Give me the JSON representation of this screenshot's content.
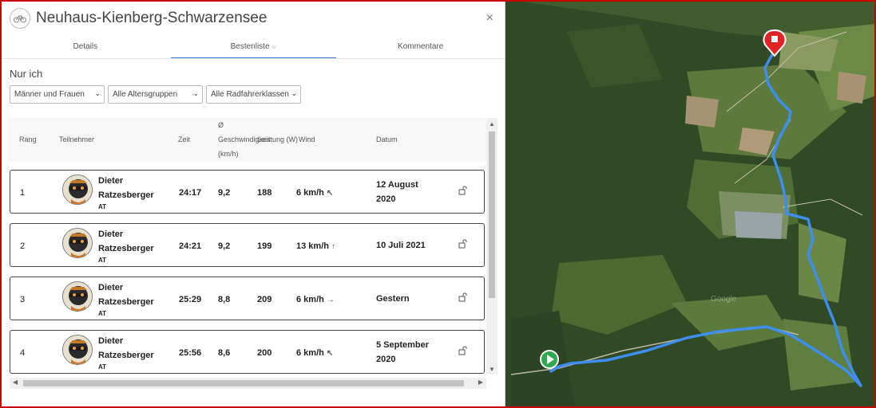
{
  "header": {
    "title": "Neuhaus-Kienberg-Schwarzensee",
    "close": "×"
  },
  "tabs": [
    {
      "label": "Details"
    },
    {
      "label": "Bestenliste",
      "caret": "⌵"
    },
    {
      "label": "Kommentare"
    }
  ],
  "filter_title": "Nur ich",
  "filters": {
    "gender": "Männer und Frauen",
    "age": "Alle Altersgruppen",
    "bike_class": "Alle Radfahrerklassen",
    "chevron": "⌄"
  },
  "columns": {
    "rank": "Rang",
    "participant": "Teilnehmer",
    "time": "Zeit",
    "avg_symbol": "Ø",
    "speed": "Geschwindigkeit",
    "speed_unit": "(km/h)",
    "power": "Leistung (W)",
    "wind": "Wind",
    "date": "Datum"
  },
  "rows": [
    {
      "rank": "1",
      "first": "Dieter",
      "last": "Ratzesberger",
      "country": "AT",
      "time": "24:17",
      "speed": "9,2",
      "power": "188",
      "wind": "6 km/h",
      "wind_arrow": "↖",
      "date1": "12 August",
      "date2": "2020"
    },
    {
      "rank": "2",
      "first": "Dieter",
      "last": "Ratzesberger",
      "country": "AT",
      "time": "24:21",
      "speed": "9,2",
      "power": "199",
      "wind": "13 km/h",
      "wind_arrow": "↑",
      "date1": "10 Juli 2021",
      "date2": ""
    },
    {
      "rank": "3",
      "first": "Dieter",
      "last": "Ratzesberger",
      "country": "AT",
      "time": "25:29",
      "speed": "8,8",
      "power": "209",
      "wind": "6 km/h",
      "wind_arrow": "→",
      "date1": "Gestern",
      "date2": ""
    },
    {
      "rank": "4",
      "first": "Dieter",
      "last": "Ratzesberger",
      "country": "AT",
      "time": "25:56",
      "speed": "8,6",
      "power": "200",
      "wind": "6 km/h",
      "wind_arrow": "↖",
      "date1": "5 September",
      "date2": "2020"
    }
  ],
  "map": {
    "watermark": "Google",
    "route_color": "#3d8ef0",
    "start_color": "#2fa84f",
    "end_color": "#e02424"
  },
  "scroll": {
    "up": "▲",
    "down": "▼",
    "left": "◀",
    "right": "▶"
  }
}
